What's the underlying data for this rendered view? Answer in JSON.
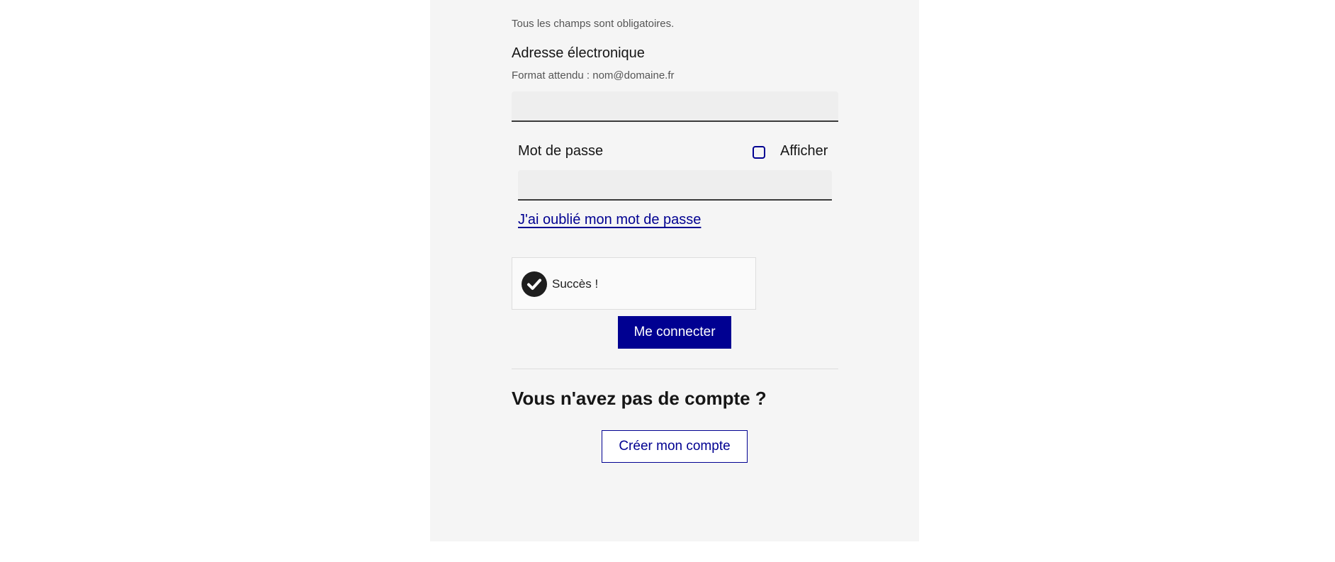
{
  "form": {
    "required_hint": "Tous les champs sont obligatoires.",
    "email": {
      "label": "Adresse électronique",
      "hint": "Format attendu : nom@domaine.fr",
      "value": "",
      "placeholder": ""
    },
    "password": {
      "label": "Mot de passe",
      "show_label": "Afficher",
      "show_checked": false,
      "value": "",
      "placeholder": ""
    },
    "forgot_link": "J'ai oublié mon mot de passe",
    "captcha": {
      "status_text": "Succès !",
      "icon": "check-circle-icon"
    },
    "submit_label": "Me connecter"
  },
  "signup": {
    "heading": "Vous n'avez pas de compte ?",
    "button_label": "Créer mon compte"
  },
  "colors": {
    "primary": "#000091",
    "panel_background": "#f5f5f5",
    "input_background": "#eeeeee",
    "text": "#161616"
  }
}
